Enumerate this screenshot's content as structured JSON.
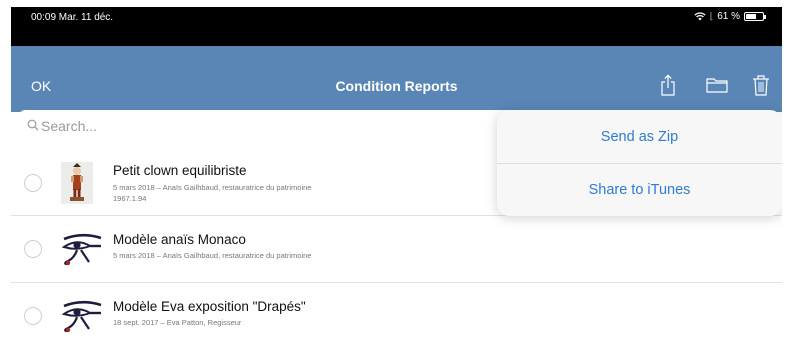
{
  "status_bar": {
    "time_date": "00:09  Mar. 11 déc.",
    "battery": "61 %",
    "battery_level": 0.61
  },
  "nav": {
    "left_label": "OK",
    "title": "Condition Reports",
    "icons": [
      "share-icon",
      "folder-icon",
      "trash-icon"
    ]
  },
  "search": {
    "placeholder": "Search...",
    "value": ""
  },
  "reports": [
    {
      "title": "Petit clown equilibriste",
      "line1": "5 mars 2018 – Anaïs Gailhbaud, restauratrice du patrimoine",
      "line2": "1967.1.94",
      "thumbnail": "clown-figurine-photo"
    },
    {
      "title": "Modèle anaïs Monaco",
      "line1": "5 mars 2018 – Anaïs Gailhbaud, restauratrice du patrimoine",
      "thumbnail": "eye-of-horus-icon"
    },
    {
      "title": "Modèle Eva exposition \"Drapés\"",
      "line1": "18 sept. 2017 – Eva Patton, Regisseur",
      "thumbnail": "eye-of-horus-icon"
    }
  ],
  "share_menu": {
    "items": [
      "Send as Zip",
      "Share to iTunes"
    ]
  },
  "colors": {
    "nav_bar": "#5a86b6",
    "menu_text": "#2e7bcf",
    "status_bar": "#000000"
  }
}
